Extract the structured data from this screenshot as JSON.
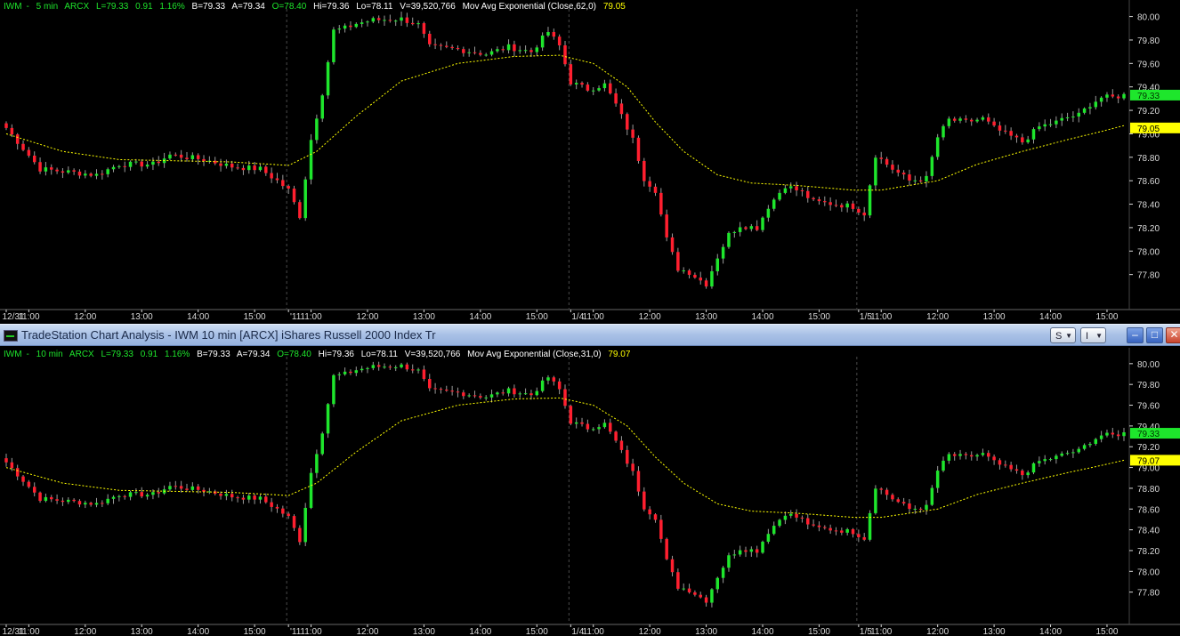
{
  "colors": {
    "up": "#1ee62c",
    "down": "#ff1f2f",
    "ema": "#ffff00",
    "grid": "#4a4a4a",
    "axis": "#d8d8d8",
    "last_tag": "#1ee62c",
    "ema_tag": "#ffff00"
  },
  "header": {
    "symbol": "IWM",
    "close_label": "L=79.33",
    "change": "0.91",
    "change_pct": "1.16%",
    "bid": "B=79.33",
    "ask": "A=79.34",
    "open": "O=78.40",
    "high": "Hi=79.36",
    "low": "Lo=78.11",
    "volume": "V=39,520,766"
  },
  "window": {
    "title": "TradeStation Chart Analysis - IWM 10 min [ARCX] iShares Russell 2000 Index Tr",
    "s_label": "S",
    "i_label": "I",
    "minimize": "–",
    "maximize": "□",
    "close": "✕"
  },
  "chart_data": [
    {
      "type": "candlestick",
      "interval": "5 min",
      "exchange": "ARCX",
      "study": "Mov Avg Exponential (Close,62,0)",
      "study_value": "79.05",
      "last_price": "79.33",
      "ema_tag": "79.05",
      "ylim": [
        77.6,
        80.05
      ],
      "y_ticks": [
        80.0,
        79.8,
        79.6,
        79.4,
        79.2,
        79.0,
        78.8,
        78.6,
        78.4,
        78.2,
        78.0,
        77.8
      ],
      "x_ticks": [
        "12/31",
        "11:00",
        "12:00",
        "13:00",
        "14:00",
        "15:00",
        "'11",
        "11:00",
        "12:00",
        "13:00",
        "14:00",
        "15:00",
        "1/4",
        "11:00",
        "12:00",
        "13:00",
        "14:00",
        "15:00",
        "1/5",
        "11:00",
        "12:00",
        "13:00",
        "14:00",
        "15:00"
      ],
      "session_labels": [
        "12/31",
        "'11",
        "1/4",
        "1/5"
      ],
      "grid": true,
      "legend": "none"
    },
    {
      "type": "candlestick",
      "interval": "10 min",
      "exchange": "ARCX",
      "study": "Mov Avg Exponential (Close,31,0)",
      "study_value": "79.07",
      "last_price": "79.33",
      "ema_tag": "79.07",
      "ylim": [
        77.6,
        80.05
      ],
      "y_ticks": [
        80.0,
        79.8,
        79.6,
        79.4,
        79.2,
        79.0,
        78.8,
        78.6,
        78.4,
        78.2,
        78.0,
        77.8
      ],
      "x_ticks": [
        "12/31",
        "11:00",
        "12:00",
        "13:00",
        "14:00",
        "15:00",
        "'11",
        "11:00",
        "12:00",
        "13:00",
        "14:00",
        "15:00",
        "1/4",
        "11:00",
        "12:00",
        "13:00",
        "14:00",
        "15:00",
        "1/5",
        "11:00",
        "12:00",
        "13:00",
        "14:00",
        "15:00"
      ],
      "session_labels": [
        "12/31",
        "'11",
        "1/4",
        "1/5"
      ],
      "grid": true,
      "legend": "none",
      "price_anchors": [
        [
          0,
          79.05
        ],
        [
          6,
          78.7
        ],
        [
          16,
          78.65
        ],
        [
          20,
          78.74
        ],
        [
          26,
          78.74
        ],
        [
          29,
          78.82
        ],
        [
          35,
          78.78
        ],
        [
          40,
          78.72
        ],
        [
          45,
          78.7
        ],
        [
          48,
          78.6
        ],
        [
          50,
          78.52
        ],
        [
          52,
          78.3
        ],
        [
          54,
          78.95
        ],
        [
          56,
          79.35
        ],
        [
          58,
          79.88
        ],
        [
          60,
          79.9
        ],
        [
          62,
          79.94
        ],
        [
          65,
          79.97
        ],
        [
          70,
          79.98
        ],
        [
          73,
          79.93
        ],
        [
          75,
          79.74
        ],
        [
          80,
          79.72
        ],
        [
          85,
          79.68
        ],
        [
          89,
          79.74
        ],
        [
          93,
          79.7
        ],
        [
          96,
          79.87
        ],
        [
          98,
          79.75
        ],
        [
          100,
          79.44
        ],
        [
          103,
          79.38
        ],
        [
          106,
          79.42
        ],
        [
          108,
          79.25
        ],
        [
          111,
          78.95
        ],
        [
          113,
          78.62
        ],
        [
          115,
          78.52
        ],
        [
          117,
          78.1
        ],
        [
          119,
          77.85
        ],
        [
          121,
          77.82
        ],
        [
          123,
          77.75
        ],
        [
          124,
          77.72
        ],
        [
          126,
          77.95
        ],
        [
          128,
          78.14
        ],
        [
          130,
          78.22
        ],
        [
          133,
          78.2
        ],
        [
          135,
          78.38
        ],
        [
          138,
          78.56
        ],
        [
          141,
          78.5
        ],
        [
          143,
          78.42
        ],
        [
          147,
          78.4
        ],
        [
          150,
          78.38
        ],
        [
          152,
          78.32
        ],
        [
          154,
          78.82
        ],
        [
          157,
          78.7
        ],
        [
          160,
          78.6
        ],
        [
          163,
          78.62
        ],
        [
          165,
          78.97
        ],
        [
          167,
          79.12
        ],
        [
          170,
          79.1
        ],
        [
          173,
          79.13
        ],
        [
          175,
          79.05
        ],
        [
          177,
          79.0
        ],
        [
          180,
          78.93
        ],
        [
          183,
          79.06
        ],
        [
          186,
          79.1
        ],
        [
          188,
          79.14
        ],
        [
          190,
          79.16
        ],
        [
          192,
          79.25
        ],
        [
          194,
          79.31
        ],
        [
          196,
          79.31
        ],
        [
          197,
          79.32
        ],
        [
          198,
          79.33
        ]
      ],
      "ema_anchors": [
        [
          0,
          79.0
        ],
        [
          10,
          78.85
        ],
        [
          20,
          78.78
        ],
        [
          40,
          78.76
        ],
        [
          50,
          78.73
        ],
        [
          55,
          78.85
        ],
        [
          62,
          79.15
        ],
        [
          70,
          79.45
        ],
        [
          80,
          79.6
        ],
        [
          90,
          79.66
        ],
        [
          98,
          79.67
        ],
        [
          104,
          79.6
        ],
        [
          110,
          79.4
        ],
        [
          115,
          79.1
        ],
        [
          120,
          78.85
        ],
        [
          126,
          78.65
        ],
        [
          132,
          78.58
        ],
        [
          140,
          78.56
        ],
        [
          150,
          78.52
        ],
        [
          155,
          78.52
        ],
        [
          165,
          78.6
        ],
        [
          172,
          78.74
        ],
        [
          180,
          78.85
        ],
        [
          188,
          78.95
        ],
        [
          194,
          79.02
        ],
        [
          198,
          79.07
        ]
      ]
    }
  ]
}
